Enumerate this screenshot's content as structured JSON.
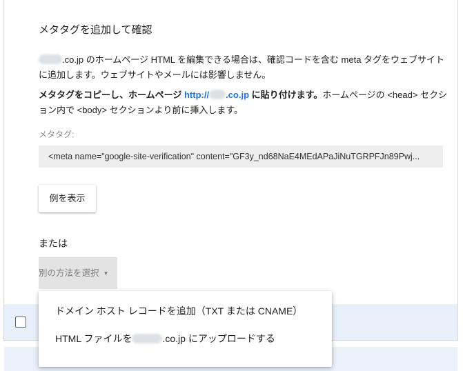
{
  "card": {
    "heading": "メタタグを追加して確認",
    "intro": {
      "domain_suffix": ".co.jp",
      "text": " のホームページ HTML を編集できる場合は、確認コードを含む meta タグをウェブサイトに追加します。ウェブサイトやメールには影響しません。"
    },
    "instruction": {
      "bold_prefix": "メタタグをコピーし、ホームページ ",
      "link_prefix": "http://",
      "link_suffix": ".co.jp",
      "bold_suffix": " に貼り付けます。",
      "text": "ホームページの <head> セクション内で <body> セクションより前に挿入します。"
    },
    "meta_label": "メタタグ:",
    "meta_value": "<meta name=\"google-site-verification\" content=\"GF3y_nd68NaE4MEdAPaJiNuTGRPFJn89Pwj...",
    "example_button": "例を表示",
    "or_label": "または",
    "method_select": "別の方法を選択",
    "method_caret": "▼"
  },
  "dropdown": {
    "items": [
      {
        "label": "ドメイン ホスト レコードを追加（TXT または CNAME）"
      },
      {
        "prefix": "HTML ファイルを",
        "suffix": ".co.jp にアップロードする"
      }
    ]
  }
}
